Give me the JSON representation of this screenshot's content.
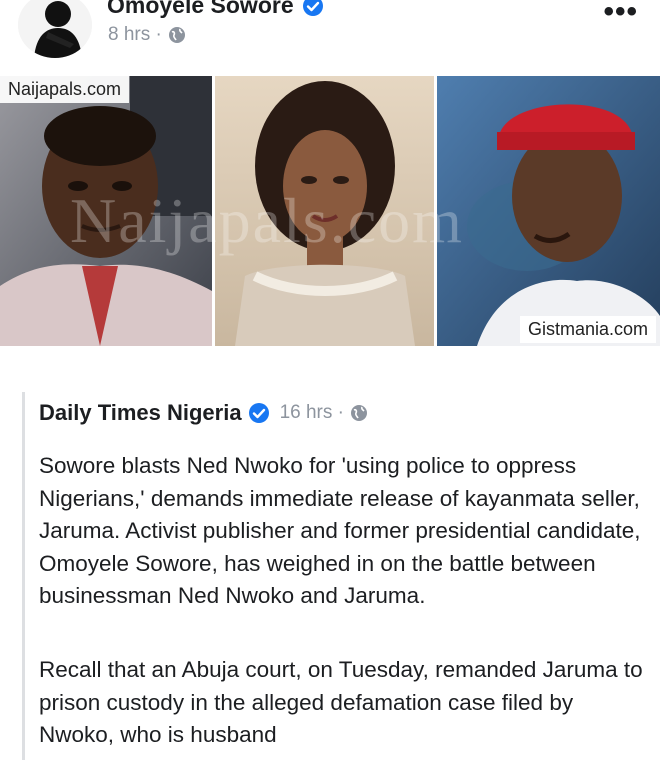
{
  "post": {
    "author": "Omoyele Sowore",
    "time": "8 hrs ·",
    "more": "•••"
  },
  "photos": {
    "watermark_left": "Naijapals.com",
    "watermark_center": "Naijapals.com",
    "watermark_right": "Gistmania.com"
  },
  "shared": {
    "author": "Daily Times Nigeria",
    "time": "16 hrs ·",
    "paragraph1": "Sowore blasts Ned Nwoko for 'using police to oppress Nigerians,' demands immediate release of kayanmata seller, Jaruma. Activist publisher and former presidential candidate, Omoyele Sowore, has weighed in on the battle between businessman Ned Nwoko and Jaruma.",
    "paragraph2": "Recall that an Abuja court, on Tuesday, remanded Jaruma to prison custody in the alleged defamation case filed by Nwoko, who is husband"
  },
  "colors": {
    "verified": "#1877f2",
    "meta_gray": "#8d949e",
    "text": "#1c1e21"
  },
  "icons": [
    "verified-badge-icon",
    "globe-icon",
    "more-options-icon"
  ]
}
